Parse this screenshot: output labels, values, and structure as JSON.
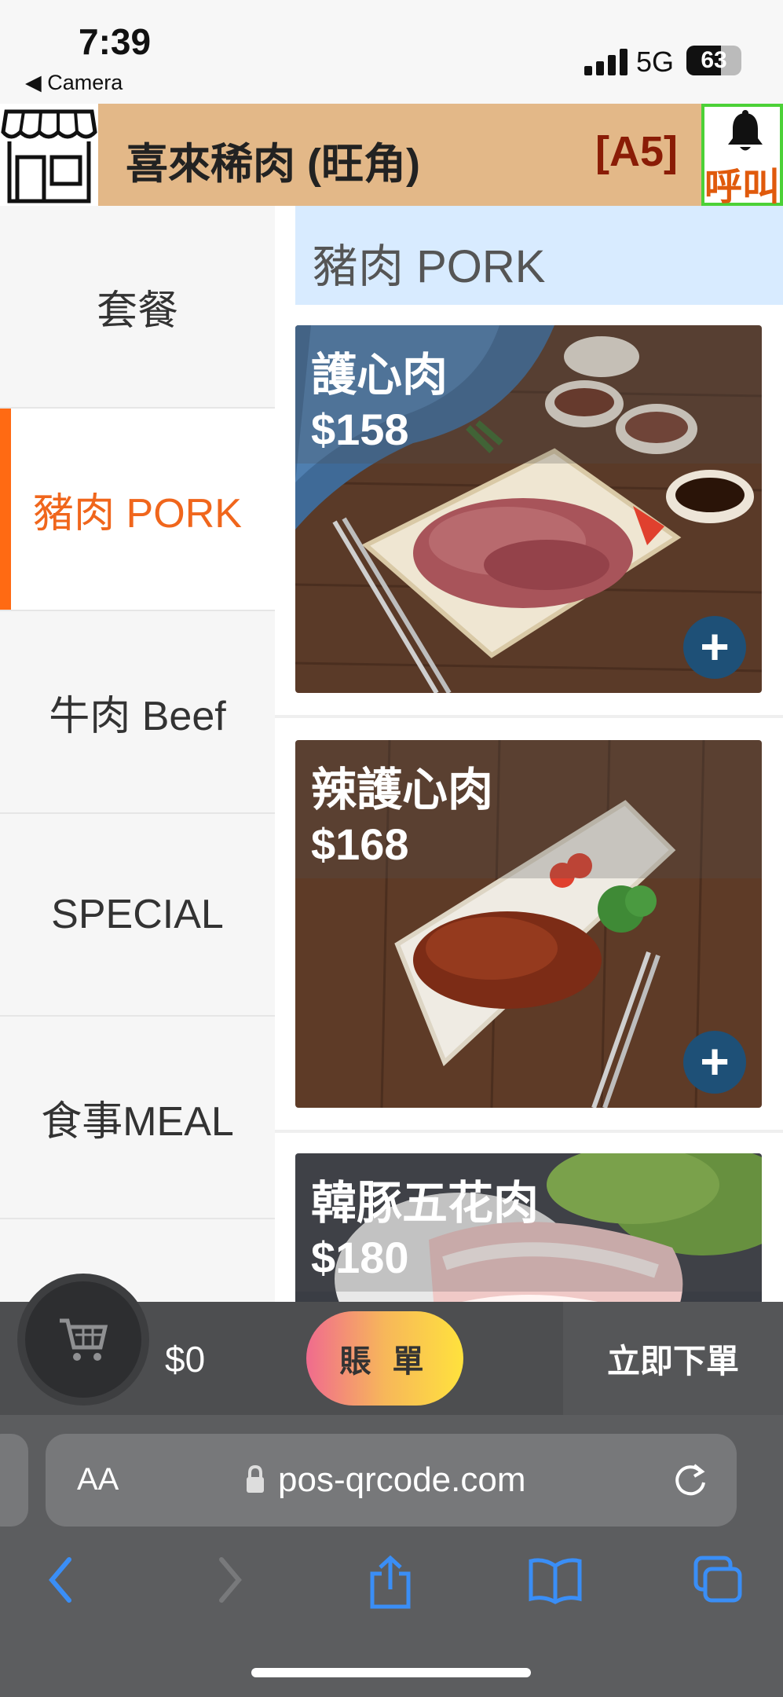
{
  "status_bar": {
    "time": "7:39",
    "back_label": "◀ Camera",
    "network": "5G",
    "battery": "63"
  },
  "header": {
    "store_name": "喜來稀肉 (旺角)",
    "table_label": "[A5]",
    "call_label": "呼叫",
    "colors": {
      "bar": "#e3b888",
      "table": "#8a1c06",
      "call_border": "#4cd137",
      "call_text": "#e05a0c"
    }
  },
  "sidebar": {
    "categories": [
      {
        "label": "套餐",
        "active": false
      },
      {
        "label": "豬肉 PORK",
        "active": true
      },
      {
        "label": "牛肉 Beef",
        "active": false
      },
      {
        "label": "SPECIAL",
        "active": false
      },
      {
        "label": "食事MEAL",
        "active": false
      }
    ],
    "active_color": "#f0661c"
  },
  "menu": {
    "section_title": "豬肉 PORK",
    "items": [
      {
        "name": "護心肉",
        "price": "$158",
        "add_icon": "plus-icon"
      },
      {
        "name": "辣護心肉",
        "price": "$168",
        "add_icon": "plus-icon"
      },
      {
        "name": "韓豚五花肉",
        "price": "$180",
        "add_icon": "plus-icon"
      }
    ]
  },
  "order_bar": {
    "cart_icon": "cart-icon",
    "total": "$0",
    "bill_label": "賬 單",
    "order_label": "立即下單"
  },
  "browser": {
    "text_size_label": "AA",
    "url": "pos-qrcode.com",
    "icons": [
      "back-icon",
      "forward-icon",
      "share-icon",
      "bookmarks-icon",
      "tabs-icon"
    ]
  }
}
